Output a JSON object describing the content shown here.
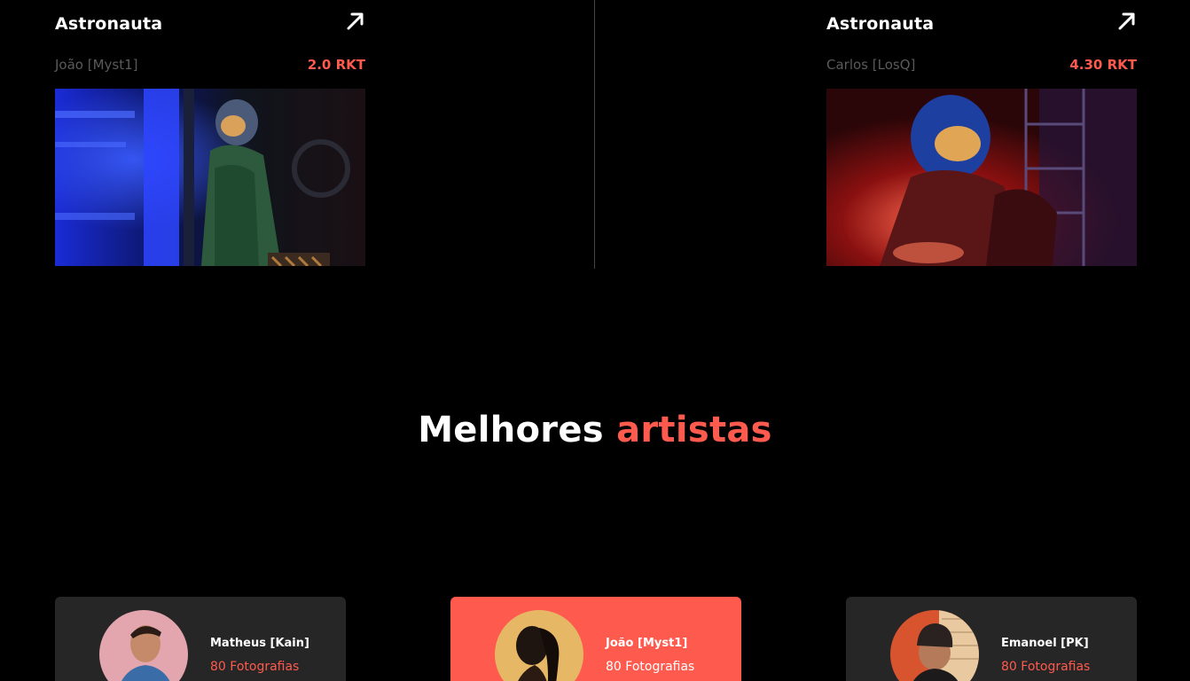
{
  "products": [
    {
      "title": "Astronauta",
      "artist": "João [Myst1]",
      "price": "2.0 RKT",
      "icon": "arrow-up-right-icon"
    },
    {
      "title": "Astronauta",
      "artist": "Carlos [LosQ]",
      "price": "4.30 RKT",
      "icon": "arrow-up-right-icon"
    }
  ],
  "section": {
    "title_main": "Melhores",
    "title_accent": "artistas"
  },
  "artists": [
    {
      "name": "Matheus [Kain]",
      "count": "80 Fotografias"
    },
    {
      "name": "João [Myst1]",
      "count": "80 Fotografias"
    },
    {
      "name": "Emanoel [PK]",
      "count": "80 Fotografias"
    }
  ],
  "colors": {
    "background": "#000000",
    "accent": "#ff5a4e",
    "card": "#262626",
    "muted_text": "#5a5a5a"
  }
}
